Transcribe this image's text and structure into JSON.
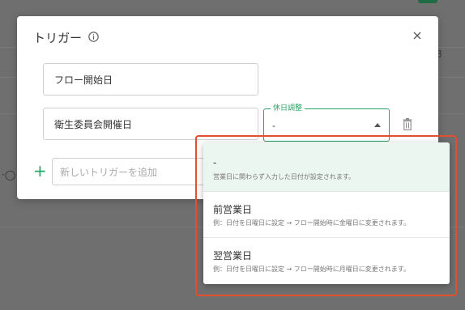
{
  "dialog": {
    "title": "トリガー",
    "fields": [
      {
        "value": "フロー開始日"
      },
      {
        "value": "衛生委員会開催日"
      }
    ],
    "adjust_select": {
      "legend": "休日調整",
      "value": "-"
    },
    "add_trigger": {
      "placeholder": "新しいトリガーを追加"
    }
  },
  "dropdown": {
    "options": [
      {
        "title": "-",
        "description": "営業日に関わらず入力した日付が設定されます。"
      },
      {
        "title": "前営業日",
        "description": "例：日付を日曜日に設定 → フロー開始時に金曜日に変更されます。"
      },
      {
        "title": "翌営業日",
        "description": "例：日付を日曜日に設定 → フロー開始時に月曜日に変更されます。"
      }
    ]
  },
  "colors": {
    "accent": "#2aa566",
    "highlight": "#e0502c",
    "selected_bg": "#ecf6f0"
  }
}
